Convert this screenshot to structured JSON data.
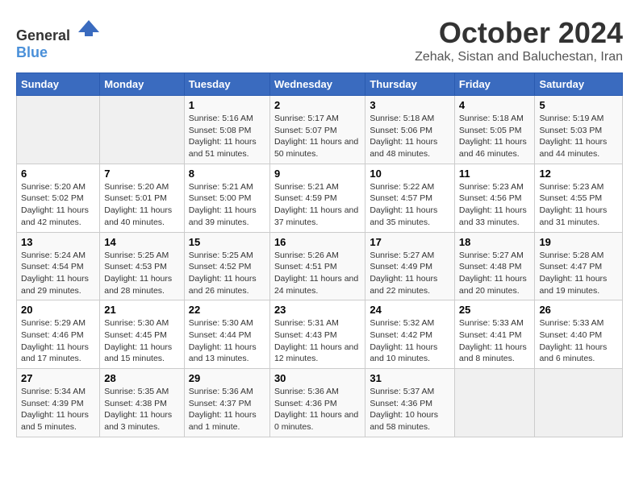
{
  "logo": {
    "text_general": "General",
    "text_blue": "Blue"
  },
  "title": "October 2024",
  "subtitle": "Zehak, Sistan and Baluchestan, Iran",
  "days_of_week": [
    "Sunday",
    "Monday",
    "Tuesday",
    "Wednesday",
    "Thursday",
    "Friday",
    "Saturday"
  ],
  "weeks": [
    [
      {
        "day": null,
        "sunrise": null,
        "sunset": null,
        "daylight": null
      },
      {
        "day": null,
        "sunrise": null,
        "sunset": null,
        "daylight": null
      },
      {
        "day": "1",
        "sunrise": "5:16 AM",
        "sunset": "5:08 PM",
        "daylight": "11 hours and 51 minutes."
      },
      {
        "day": "2",
        "sunrise": "5:17 AM",
        "sunset": "5:07 PM",
        "daylight": "11 hours and 50 minutes."
      },
      {
        "day": "3",
        "sunrise": "5:18 AM",
        "sunset": "5:06 PM",
        "daylight": "11 hours and 48 minutes."
      },
      {
        "day": "4",
        "sunrise": "5:18 AM",
        "sunset": "5:05 PM",
        "daylight": "11 hours and 46 minutes."
      },
      {
        "day": "5",
        "sunrise": "5:19 AM",
        "sunset": "5:03 PM",
        "daylight": "11 hours and 44 minutes."
      }
    ],
    [
      {
        "day": "6",
        "sunrise": "5:20 AM",
        "sunset": "5:02 PM",
        "daylight": "11 hours and 42 minutes."
      },
      {
        "day": "7",
        "sunrise": "5:20 AM",
        "sunset": "5:01 PM",
        "daylight": "11 hours and 40 minutes."
      },
      {
        "day": "8",
        "sunrise": "5:21 AM",
        "sunset": "5:00 PM",
        "daylight": "11 hours and 39 minutes."
      },
      {
        "day": "9",
        "sunrise": "5:21 AM",
        "sunset": "4:59 PM",
        "daylight": "11 hours and 37 minutes."
      },
      {
        "day": "10",
        "sunrise": "5:22 AM",
        "sunset": "4:57 PM",
        "daylight": "11 hours and 35 minutes."
      },
      {
        "day": "11",
        "sunrise": "5:23 AM",
        "sunset": "4:56 PM",
        "daylight": "11 hours and 33 minutes."
      },
      {
        "day": "12",
        "sunrise": "5:23 AM",
        "sunset": "4:55 PM",
        "daylight": "11 hours and 31 minutes."
      }
    ],
    [
      {
        "day": "13",
        "sunrise": "5:24 AM",
        "sunset": "4:54 PM",
        "daylight": "11 hours and 29 minutes."
      },
      {
        "day": "14",
        "sunrise": "5:25 AM",
        "sunset": "4:53 PM",
        "daylight": "11 hours and 28 minutes."
      },
      {
        "day": "15",
        "sunrise": "5:25 AM",
        "sunset": "4:52 PM",
        "daylight": "11 hours and 26 minutes."
      },
      {
        "day": "16",
        "sunrise": "5:26 AM",
        "sunset": "4:51 PM",
        "daylight": "11 hours and 24 minutes."
      },
      {
        "day": "17",
        "sunrise": "5:27 AM",
        "sunset": "4:49 PM",
        "daylight": "11 hours and 22 minutes."
      },
      {
        "day": "18",
        "sunrise": "5:27 AM",
        "sunset": "4:48 PM",
        "daylight": "11 hours and 20 minutes."
      },
      {
        "day": "19",
        "sunrise": "5:28 AM",
        "sunset": "4:47 PM",
        "daylight": "11 hours and 19 minutes."
      }
    ],
    [
      {
        "day": "20",
        "sunrise": "5:29 AM",
        "sunset": "4:46 PM",
        "daylight": "11 hours and 17 minutes."
      },
      {
        "day": "21",
        "sunrise": "5:30 AM",
        "sunset": "4:45 PM",
        "daylight": "11 hours and 15 minutes."
      },
      {
        "day": "22",
        "sunrise": "5:30 AM",
        "sunset": "4:44 PM",
        "daylight": "11 hours and 13 minutes."
      },
      {
        "day": "23",
        "sunrise": "5:31 AM",
        "sunset": "4:43 PM",
        "daylight": "11 hours and 12 minutes."
      },
      {
        "day": "24",
        "sunrise": "5:32 AM",
        "sunset": "4:42 PM",
        "daylight": "11 hours and 10 minutes."
      },
      {
        "day": "25",
        "sunrise": "5:33 AM",
        "sunset": "4:41 PM",
        "daylight": "11 hours and 8 minutes."
      },
      {
        "day": "26",
        "sunrise": "5:33 AM",
        "sunset": "4:40 PM",
        "daylight": "11 hours and 6 minutes."
      }
    ],
    [
      {
        "day": "27",
        "sunrise": "5:34 AM",
        "sunset": "4:39 PM",
        "daylight": "11 hours and 5 minutes."
      },
      {
        "day": "28",
        "sunrise": "5:35 AM",
        "sunset": "4:38 PM",
        "daylight": "11 hours and 3 minutes."
      },
      {
        "day": "29",
        "sunrise": "5:36 AM",
        "sunset": "4:37 PM",
        "daylight": "11 hours and 1 minute."
      },
      {
        "day": "30",
        "sunrise": "5:36 AM",
        "sunset": "4:36 PM",
        "daylight": "11 hours and 0 minutes."
      },
      {
        "day": "31",
        "sunrise": "5:37 AM",
        "sunset": "4:36 PM",
        "daylight": "10 hours and 58 minutes."
      },
      {
        "day": null,
        "sunrise": null,
        "sunset": null,
        "daylight": null
      },
      {
        "day": null,
        "sunrise": null,
        "sunset": null,
        "daylight": null
      }
    ]
  ]
}
